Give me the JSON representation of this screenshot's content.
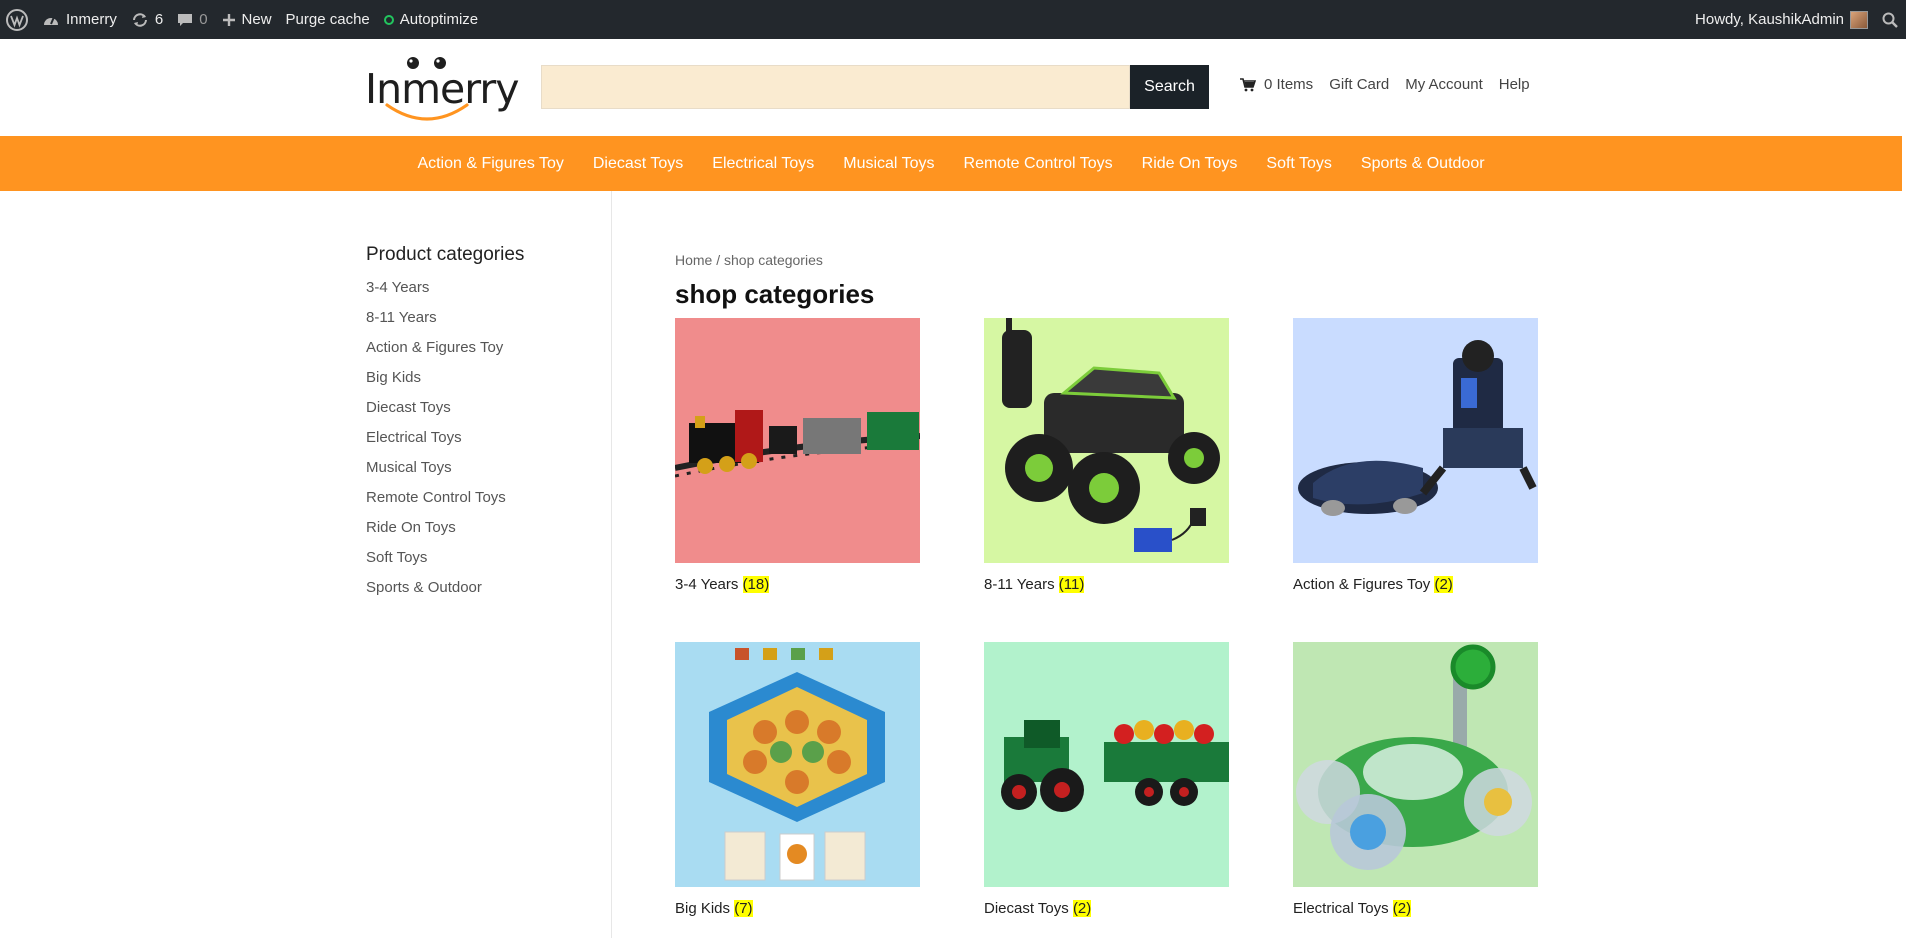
{
  "adminbar": {
    "site_name": "Inmerry",
    "updates_count": "6",
    "comments_count": "0",
    "new_label": "New",
    "purge_label": "Purge cache",
    "autoptimize_label": "Autoptimize",
    "greeting": "Howdy, KaushikAdmin"
  },
  "header": {
    "logo_text": "Inmerry",
    "search_placeholder": "",
    "search_button": "Search",
    "cart_label": "0 Items",
    "gift_card": "Gift Card",
    "my_account": "My Account",
    "help": "Help"
  },
  "nav": [
    "Action & Figures Toy",
    "Diecast Toys",
    "Electrical Toys",
    "Musical Toys",
    "Remote Control Toys",
    "Ride On Toys",
    "Soft Toys",
    "Sports & Outdoor"
  ],
  "sidebar": {
    "title": "Product categories",
    "items": [
      "3-4 Years",
      "8-11 Years",
      "Action & Figures Toy",
      "Big Kids",
      "Diecast Toys",
      "Electrical Toys",
      "Musical Toys",
      "Remote Control Toys",
      "Ride On Toys",
      "Soft Toys",
      "Sports & Outdoor"
    ]
  },
  "main": {
    "breadcrumb": "Home / shop categories",
    "title": "shop categories",
    "categories": [
      {
        "name": "3-4 Years",
        "count": "(18)",
        "bg": "#f08c8c"
      },
      {
        "name": "8-11 Years",
        "count": "(11)",
        "bg": "#d6f7a3"
      },
      {
        "name": "Action & Figures Toy",
        "count": "(2)",
        "bg": "#c9dcff"
      },
      {
        "name": "Big Kids",
        "count": "(7)",
        "bg": "#a9dcf2"
      },
      {
        "name": "Diecast Toys",
        "count": "(2)",
        "bg": "#b2f2cc"
      },
      {
        "name": "Electrical Toys",
        "count": "(2)",
        "bg": "#bfe7b3"
      }
    ]
  },
  "colors": {
    "adminbar": "#23282d",
    "nav": "#ff9420",
    "search_bg": "#faebd1",
    "search_button": "#1b2228",
    "highlight": "#ffff00"
  }
}
